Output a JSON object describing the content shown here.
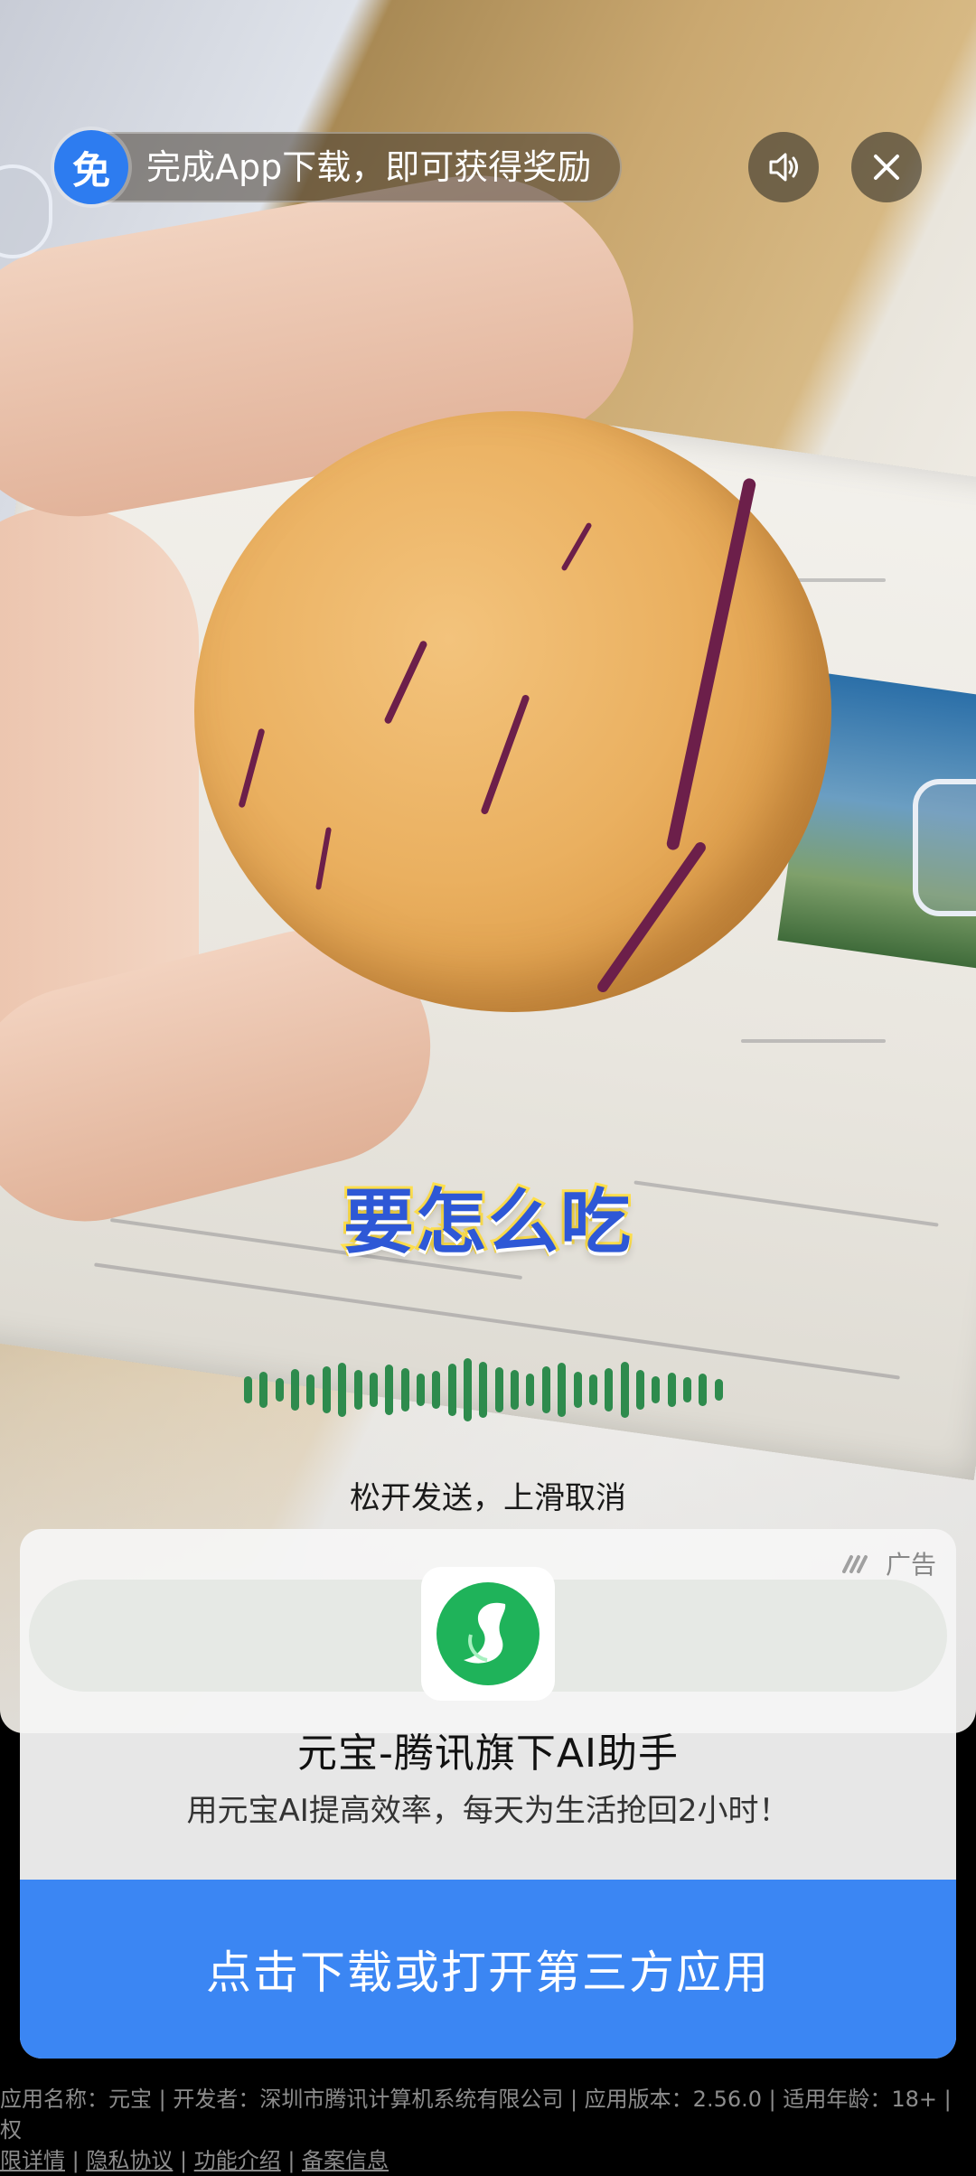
{
  "top_bar": {
    "free_badge": "免",
    "reward_text": "完成App下载，即可获得奖励",
    "sound_icon": "speaker-icon",
    "close_icon": "close-icon"
  },
  "video": {
    "caption": "要怎么吃"
  },
  "voice": {
    "hint": "松开发送，上滑取消",
    "wave_color": "#2e8b4d"
  },
  "ad": {
    "tag": "广告",
    "app_name": "元宝-腾讯旗下AI助手",
    "description": "用元宝AI提高效率，每天为生活抢回2小时！",
    "cta": "点击下载或打开第三方应用",
    "cta_color": "#3b86f3",
    "icon_color": "#1fb35a"
  },
  "footer": {
    "line1": "应用名称：元宝 | 开发者：深圳市腾讯计算机系统有限公司 | 应用版本：2.56.0 | 适用年龄：18+ | 权",
    "link_permissions_tail": "限详情",
    "sep1": " | ",
    "link_privacy": "隐私协议",
    "sep2": " | ",
    "link_features": "功能介绍",
    "sep3": " | ",
    "link_filing": "备案信息"
  }
}
